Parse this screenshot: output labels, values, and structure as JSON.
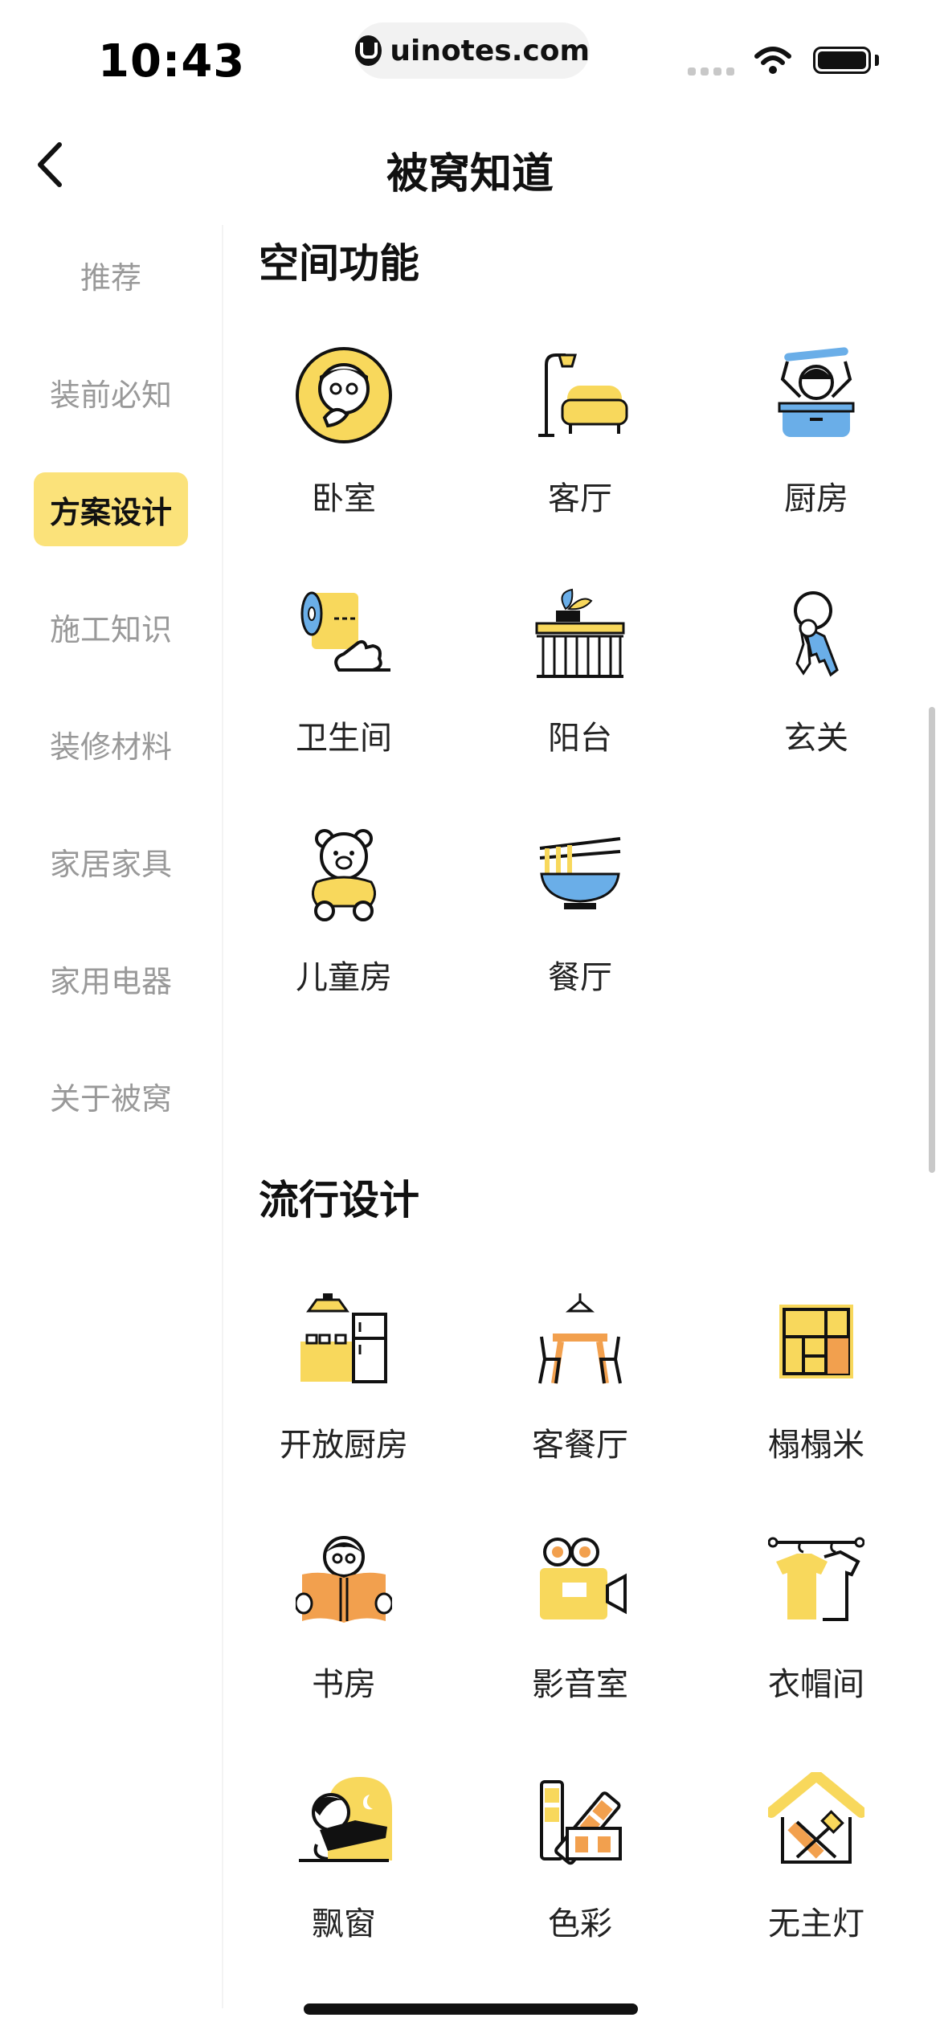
{
  "status_bar": {
    "time": "10:43",
    "url": "uinotes.com"
  },
  "nav": {
    "title": "被窝知道",
    "back_icon": "chevron-left-icon"
  },
  "sidebar": {
    "items": [
      {
        "label": "推荐",
        "active": false
      },
      {
        "label": "装前必知",
        "active": false
      },
      {
        "label": "方案设计",
        "active": true
      },
      {
        "label": "施工知识",
        "active": false
      },
      {
        "label": "装修材料",
        "active": false
      },
      {
        "label": "家居家具",
        "active": false
      },
      {
        "label": "家用电器",
        "active": false
      },
      {
        "label": "关于被窝",
        "active": false
      }
    ]
  },
  "sections": [
    {
      "title": "空间功能",
      "items": [
        {
          "label": "卧室",
          "icon": "bedroom-icon"
        },
        {
          "label": "客厅",
          "icon": "living-room-icon"
        },
        {
          "label": "厨房",
          "icon": "kitchen-icon"
        },
        {
          "label": "卫生间",
          "icon": "bathroom-icon"
        },
        {
          "label": "阳台",
          "icon": "balcony-icon"
        },
        {
          "label": "玄关",
          "icon": "entrance-icon"
        },
        {
          "label": "儿童房",
          "icon": "kids-room-icon"
        },
        {
          "label": "餐厅",
          "icon": "dining-room-icon"
        }
      ]
    },
    {
      "title": "流行设计",
      "items": [
        {
          "label": "开放厨房",
          "icon": "open-kitchen-icon"
        },
        {
          "label": "客餐厅",
          "icon": "living-dining-icon"
        },
        {
          "label": "榻榻米",
          "icon": "tatami-icon"
        },
        {
          "label": "书房",
          "icon": "study-icon"
        },
        {
          "label": "影音室",
          "icon": "theater-icon"
        },
        {
          "label": "衣帽间",
          "icon": "cloakroom-icon"
        },
        {
          "label": "飘窗",
          "icon": "bay-window-icon"
        },
        {
          "label": "色彩",
          "icon": "color-icon"
        },
        {
          "label": "无主灯",
          "icon": "no-main-light-icon"
        }
      ]
    }
  ],
  "colors": {
    "accent_yellow": "#fbe27a",
    "icon_yellow": "#f8d85c",
    "icon_blue": "#6aaee8",
    "icon_orange": "#f2a04e",
    "inactive_text": "#999999"
  }
}
